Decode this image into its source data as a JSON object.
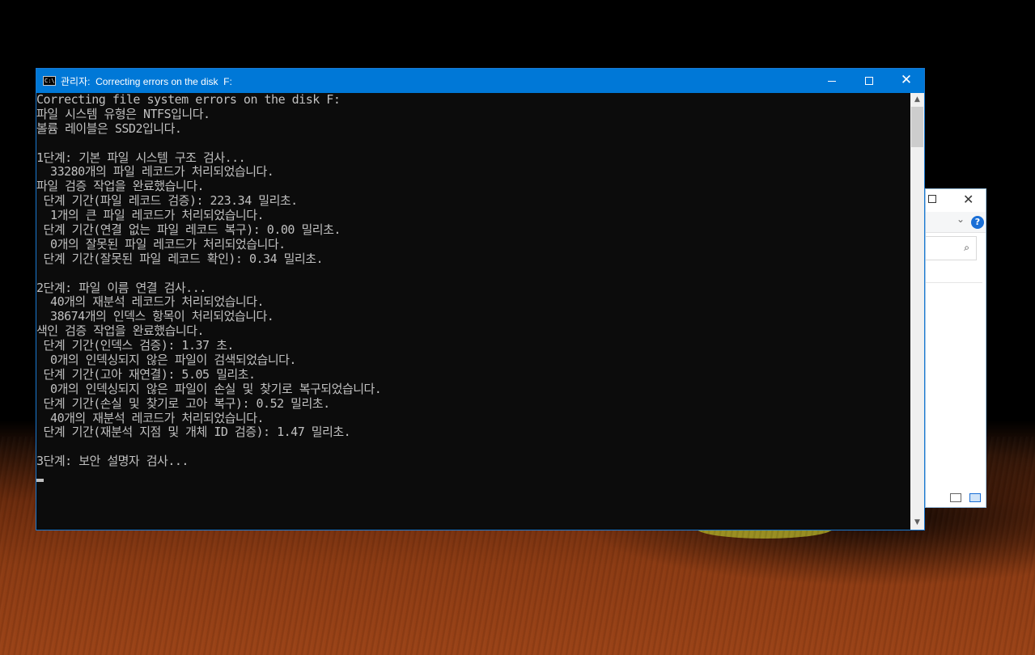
{
  "console": {
    "title": "관리자:  Correcting errors on the disk  F:",
    "app_icon_label": "C:\\",
    "close_glyph": "✕",
    "lines": [
      "Correcting file system errors on the disk F:",
      "파일 시스템 유형은 NTFS입니다.",
      "볼륨 레이블은 SSD2입니다.",
      "",
      "1단계: 기본 파일 시스템 구조 검사...",
      "  33280개의 파일 레코드가 처리되었습니다.",
      "파일 검증 작업을 완료했습니다.",
      " 단계 기간(파일 레코드 검증): 223.34 밀리초.",
      "  1개의 큰 파일 레코드가 처리되었습니다.",
      " 단계 기간(연결 없는 파일 레코드 복구): 0.00 밀리초.",
      "  0개의 잘못된 파일 레코드가 처리되었습니다.",
      " 단계 기간(잘못된 파일 레코드 확인): 0.34 밀리초.",
      "",
      "2단계: 파일 이름 연결 검사...",
      "  40개의 재분석 레코드가 처리되었습니다.",
      "  38674개의 인덱스 항목이 처리되었습니다.",
      "색인 검증 작업을 완료했습니다.",
      " 단계 기간(인덱스 검증): 1.37 초.",
      "  0개의 인덱싱되지 않은 파일이 검색되었습니다.",
      " 단계 기간(고아 재연결): 5.05 밀리초.",
      "  0개의 인덱싱되지 않은 파일이 손실 및 찾기로 복구되었습니다.",
      " 단계 기간(손실 및 찾기로 고아 복구): 0.52 밀리초.",
      "  40개의 재분석 레코드가 처리되었습니다.",
      " 단계 기간(재분석 지점 및 개체 ID 검증): 1.47 밀리초.",
      "",
      "3단계: 보안 설명자 검사..."
    ]
  },
  "explorer": {
    "close_glyph": "✕",
    "chevron_glyph": "⌄",
    "help_glyph": "?",
    "search_glyph": "⌕"
  },
  "colors": {
    "titlebar": "#0078d7",
    "console_bg": "#0c0c0c",
    "console_text": "#c0c0c0"
  }
}
